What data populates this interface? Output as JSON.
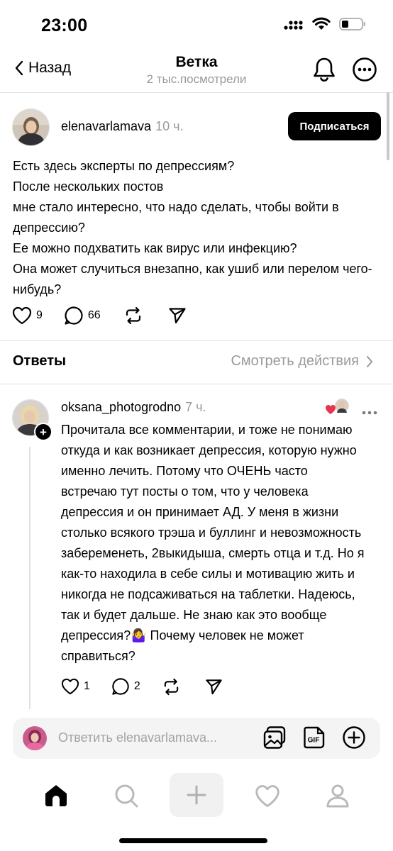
{
  "status_bar": {
    "time": "23:00"
  },
  "header": {
    "back_label": "Назад",
    "title": "Ветка",
    "subtitle": "2 тыс.посмотрели"
  },
  "post": {
    "author": "elenavarlamava",
    "time": "10 ч.",
    "follow_label": "Подписаться",
    "lines": [
      "Есть здесь эксперты по депрессиям?",
      "После нескольких постов",
      "мне стало интересно, что надо сделать, чтобы войти в депрессию?",
      "Ее можно подхватить как вирус или инфекцию?",
      "Она может случиться внезапно, как ушиб или перелом чего-нибудь?"
    ],
    "likes": "9",
    "comments": "66"
  },
  "replies_section": {
    "title": "Ответы",
    "activity_label": "Смотреть действия"
  },
  "reply": {
    "author": "oksana_photogrodno",
    "time": "7 ч.",
    "text": "Прочитала все комментарии, и тоже не понимаю откуда и как возникает депрессия, которую нужно именно лечить. Потому что ОЧЕНЬ часто встречаю тут посты о том, что у человека депрессия и он принимает АД. У меня в жизни столько всякого трэша и буллинг и невозможность забеременеть, 2выкидыша, смерть отца и т.д. Но я как-то находила в себе силы и мотивацию жить и никогда не подсаживаться на таблетки. Надеюсь, так и будет дальше. Не знаю как это вообще депрессия?🤷‍♀️ Почему человек не может справиться?",
    "likes": "1",
    "comments": "2"
  },
  "composer": {
    "placeholder": "Ответить elenavarlamava..."
  },
  "colors": {
    "accent": "#000000",
    "muted": "#9a9a9a",
    "like_heart": "#e8344e"
  }
}
